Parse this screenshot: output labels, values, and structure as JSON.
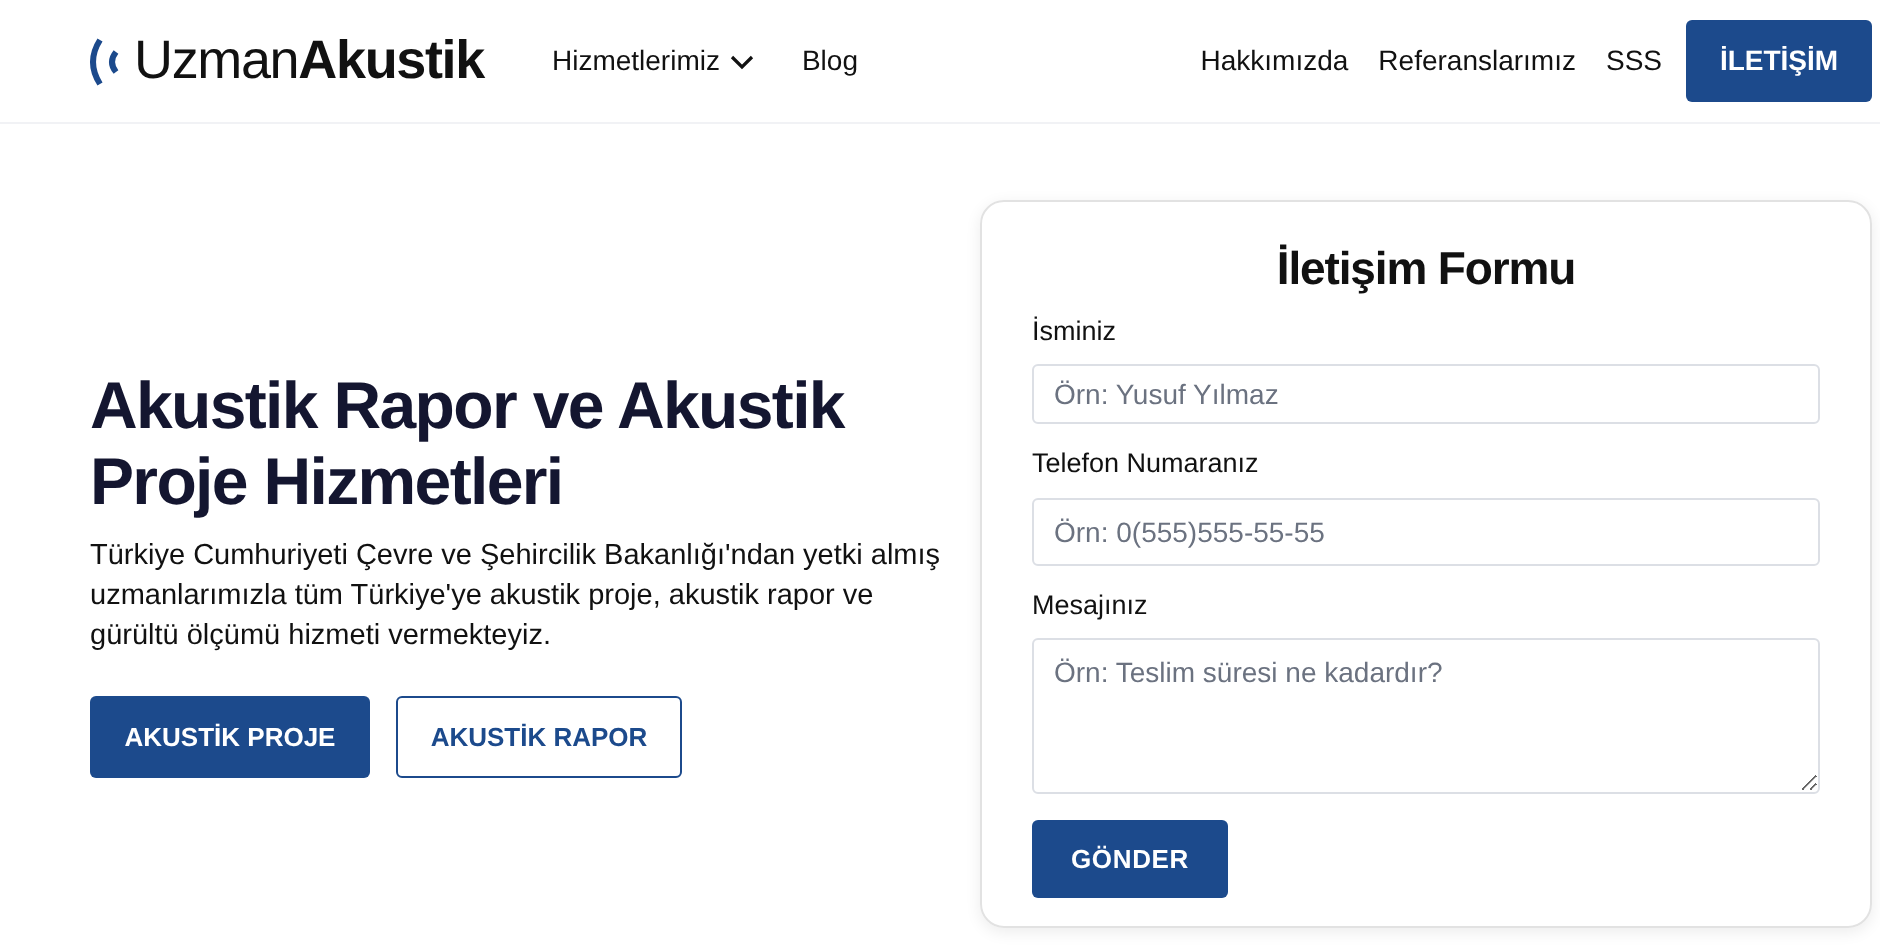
{
  "header": {
    "logo": "Uzman**Akustik**",
    "nav_left": [
      {
        "label": "Hizmetlerimiz",
        "kind": "dropdown"
      },
      {
        "label": "Blog",
        "kind": "link"
      }
    ],
    "nav_right": [
      "Hakkımızda",
      "Referanslarımız",
      "SSS"
    ],
    "cta": "İLETİŞİM"
  },
  "hero": {
    "title": "Akustik Rapor ve Akustik Proje Hizmetleri",
    "text": "Türkiye Cumhuriyeti Çevre ve Şehircilik Bakanlığı'ndan yetki almış uzmanlarımızla tüm Türkiye'ye akustik proje, akustik rapor ve gürültü ölçümü hizmeti vermekteyiz.",
    "buttons": [
      {
        "label": "AKUSTİK PROJE",
        "kind": "primary"
      },
      {
        "label": "AKUSTİK RAPOR",
        "kind": "outline"
      }
    ]
  },
  "form": {
    "title": "İletişim Formu",
    "fields": [
      {
        "label": "İsminiz",
        "placeholder": "Örn: Yusuf Yılmaz",
        "kind": "text"
      },
      {
        "label": "Telefon Numaranız",
        "placeholder": "Örn: 0(555)555-55-55",
        "kind": "text"
      },
      {
        "label": "Mesajınız",
        "placeholder": "Örn: Teslim süresi ne kadardır?",
        "kind": "textarea"
      }
    ],
    "submit": "GÖNDER"
  }
}
